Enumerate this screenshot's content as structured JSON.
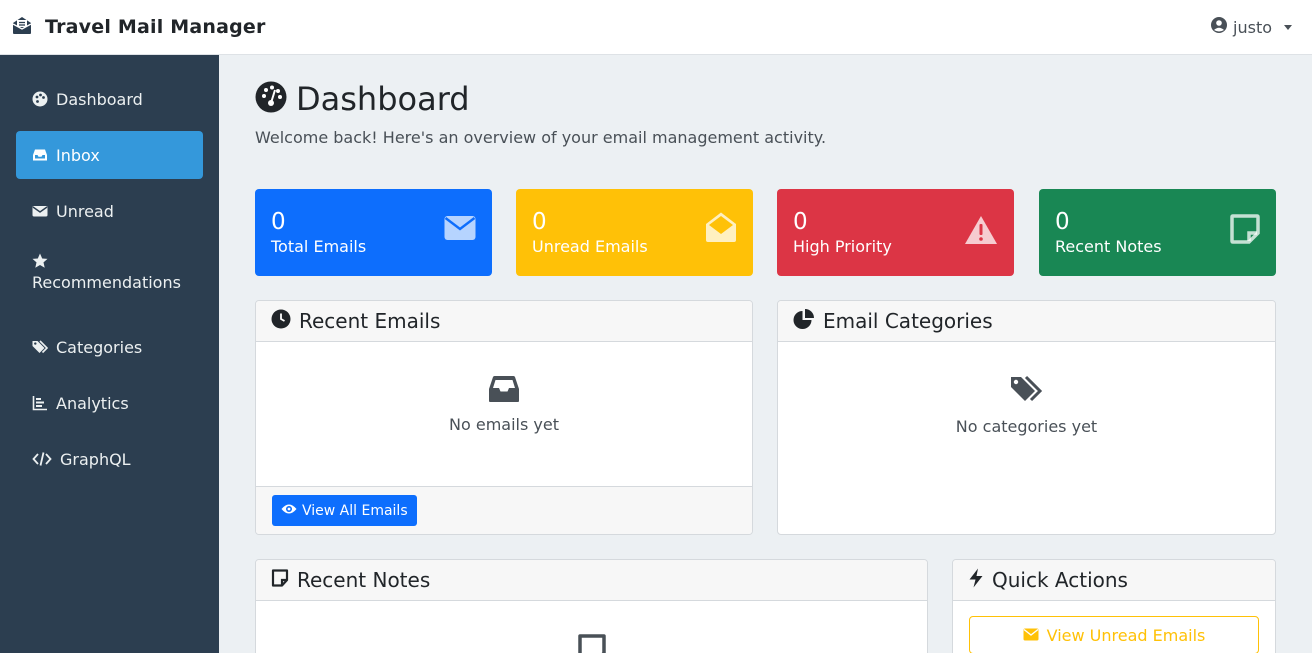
{
  "app": {
    "title": "Travel Mail Manager"
  },
  "user": {
    "name": "justo"
  },
  "sidebar": {
    "items": [
      {
        "label": "Dashboard",
        "icon": "palette-icon"
      },
      {
        "label": "Inbox",
        "icon": "inbox-icon",
        "active": true
      },
      {
        "label": "Unread",
        "icon": "envelope-icon"
      },
      {
        "label": "Recommendations",
        "icon": "star-icon"
      },
      {
        "label": "Categories",
        "icon": "tags-icon"
      },
      {
        "label": "Analytics",
        "icon": "chart-bar-icon"
      },
      {
        "label": "GraphQL",
        "icon": "code-icon"
      }
    ]
  },
  "page": {
    "title": "Dashboard",
    "welcome": "Welcome back! Here's an overview of your email management activity."
  },
  "stats": [
    {
      "value": "0",
      "label": "Total Emails",
      "color": "#0d6efd",
      "icon": "envelope-icon"
    },
    {
      "value": "0",
      "label": "Unread Emails",
      "color": "#ffc107",
      "icon": "envelope-open-icon"
    },
    {
      "value": "0",
      "label": "High Priority",
      "color": "#dc3545",
      "icon": "warning-icon"
    },
    {
      "value": "0",
      "label": "Recent Notes",
      "color": "#198754",
      "icon": "sticky-note-icon"
    }
  ],
  "recent_emails": {
    "title": "Recent Emails",
    "empty": "No emails yet",
    "button": "View All Emails"
  },
  "email_categories": {
    "title": "Email Categories",
    "empty": "No categories yet"
  },
  "recent_notes": {
    "title": "Recent Notes"
  },
  "quick_actions": {
    "title": "Quick Actions",
    "button": "View Unread Emails"
  }
}
